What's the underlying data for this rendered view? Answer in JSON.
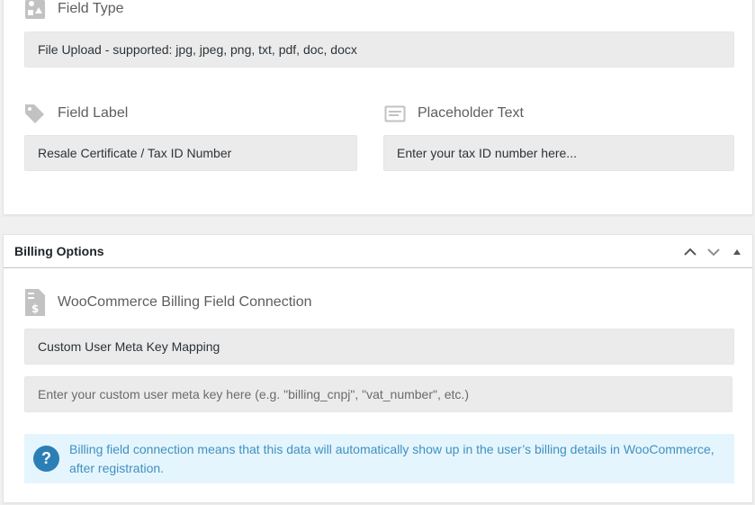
{
  "field_settings": {
    "field_type": {
      "label": "Field Type",
      "icon": "shapes-icon",
      "value": "File Upload - supported: jpg, jpeg, png, txt, pdf, doc, docx"
    },
    "field_label": {
      "label": "Field Label",
      "icon": "tag-icon",
      "value": "Resale Certificate / Tax ID Number"
    },
    "placeholder_text": {
      "label": "Placeholder Text",
      "icon": "text-lines-icon",
      "value": "Enter your tax ID number here..."
    }
  },
  "billing_options": {
    "title": "Billing Options",
    "controls": [
      "move-up-icon",
      "move-down-icon",
      "collapse-icon"
    ],
    "connection": {
      "label": "WooCommerce Billing Field Connection",
      "icon": "invoice-dollar-icon",
      "value": "Custom User Meta Key Mapping"
    },
    "meta_key_input": {
      "value": "",
      "placeholder": "Enter your custom user meta key here (e.g. \"billing_cnpj\", \"vat_number\", etc.)"
    },
    "notice": {
      "icon": "question-circle-icon",
      "text": "Billing field connection means that this data will automatically show up in the user’s billing details in WooCommerce, after registration."
    }
  },
  "colors": {
    "input_bg": "#ebebeb",
    "notice_bg": "#e5f5fd",
    "notice_text": "#3f91c1",
    "notice_icon_bg": "#2b7fb6",
    "icon_gray": "#c2c2c2"
  }
}
